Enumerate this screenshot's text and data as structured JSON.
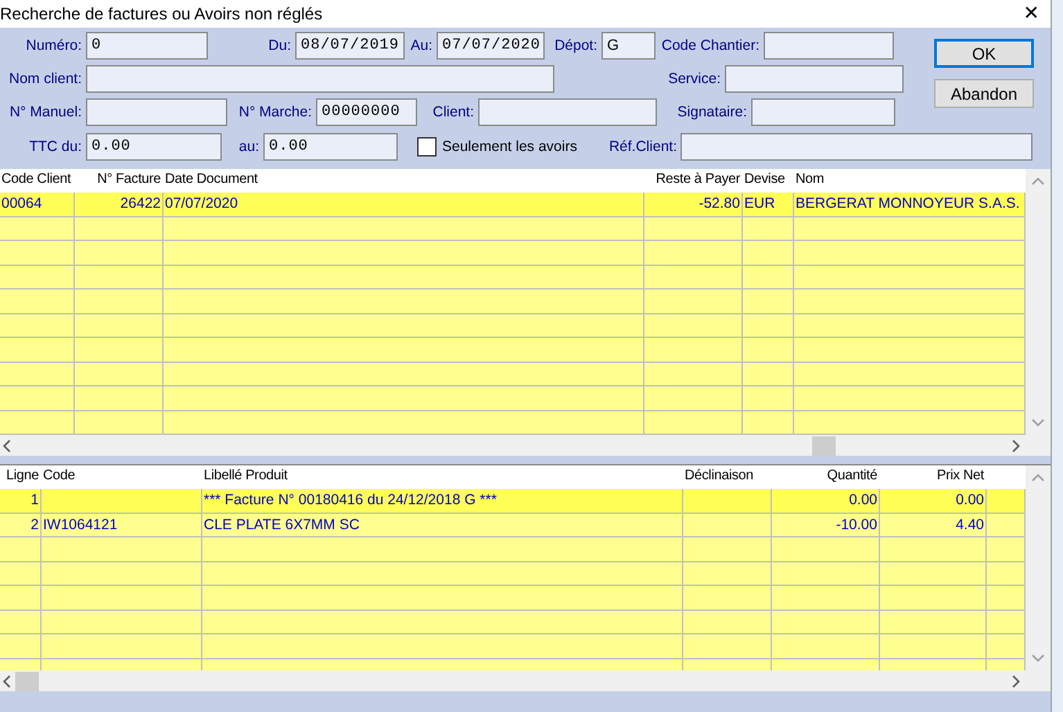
{
  "window": {
    "title": "Recherche de factures ou Avoirs non réglés",
    "close": "✕"
  },
  "form": {
    "numero": {
      "label": "Numéro:",
      "value": "0"
    },
    "du": {
      "label": "Du:",
      "value": "08/07/2019"
    },
    "au_date": {
      "label": "Au:",
      "value": "07/07/2020"
    },
    "depot": {
      "label": "Dépot:",
      "value": "G"
    },
    "code_chantier": {
      "label": "Code Chantier:"
    },
    "nom_client": {
      "label": "Nom client:"
    },
    "service": {
      "label": "Service:"
    },
    "n_manuel": {
      "label": "N° Manuel:"
    },
    "n_marche": {
      "label": "N° Marche:",
      "value": "00000000"
    },
    "client": {
      "label": "Client:"
    },
    "signataire": {
      "label": "Signataire:"
    },
    "ttc_du": {
      "label": "TTC du:",
      "value": "0.00"
    },
    "ttc_au": {
      "label": "au:",
      "value": "0.00"
    },
    "seulement_avoirs": {
      "label": "Seulement les avoirs",
      "checked": false
    },
    "ref_client": {
      "label": "Réf.Client:"
    }
  },
  "buttons": [
    {
      "label": "OK",
      "default": true
    },
    {
      "label": "Abandon",
      "default": false
    }
  ],
  "invoices": {
    "columns": [
      "Code Client",
      "N° Facture",
      "Date Document",
      "Reste à Payer",
      "Devise",
      "Nom"
    ],
    "rows": [
      {
        "cells": [
          "00064",
          "26422",
          "07/07/2020",
          "-52.80",
          "EUR",
          "BERGERAT MONNOYEUR S.A.S."
        ],
        "selected": true
      }
    ]
  },
  "lines": {
    "columns": [
      "Ligne",
      "Code",
      "Libellé Produit",
      "Déclinaison",
      "Quantité",
      "Prix Net"
    ],
    "rows": [
      {
        "cells": [
          "1",
          "",
          "*** Facture N° 00180416 du 24/12/2018 G ***",
          "",
          "0.00",
          "0.00"
        ],
        "selected": true
      },
      {
        "cells": [
          "2",
          "IW1064121",
          "CLE PLATE 6X7MM SC",
          "",
          "-10.00",
          "4.40"
        ],
        "selected": false
      }
    ]
  }
}
